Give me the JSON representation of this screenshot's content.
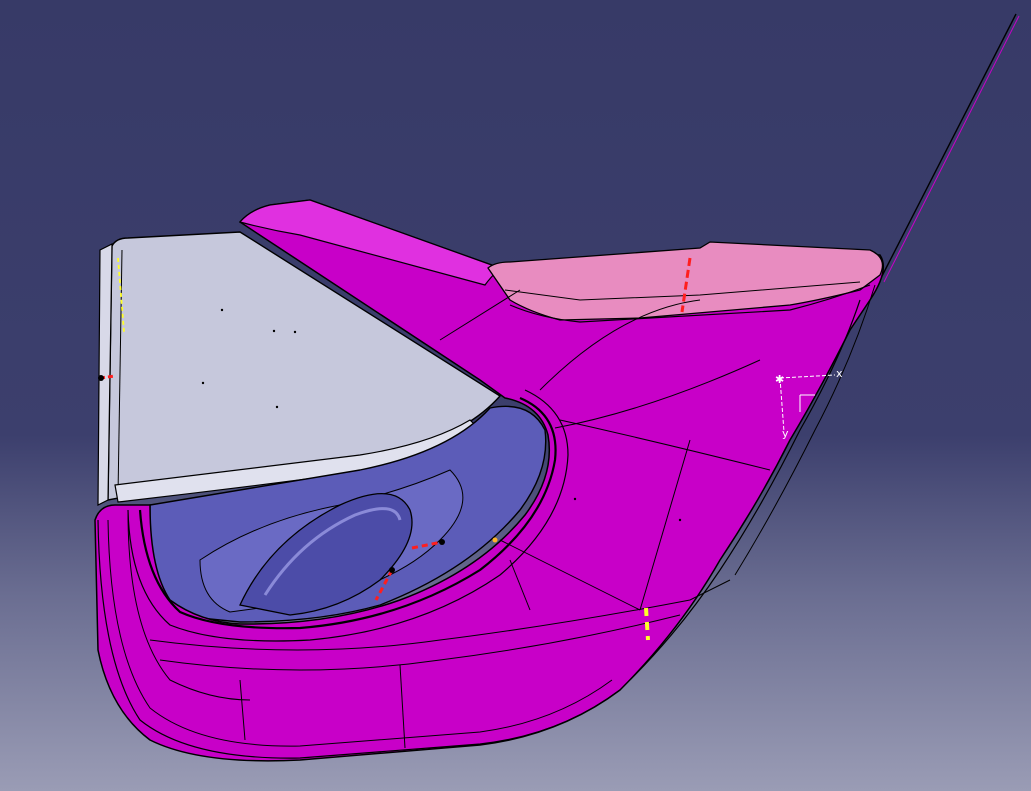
{
  "viewer": {
    "background_top": "#373a67",
    "background_bottom": "#9a9cb5"
  },
  "part": {
    "outer_color": "#c800c8",
    "outer_highlight": "#e020e0",
    "inner_color": "#5a5ab4",
    "window_color": "#c8cade",
    "flange_color": "#e88cc0"
  },
  "compass": {
    "x_label": "x",
    "y_label": "y"
  }
}
